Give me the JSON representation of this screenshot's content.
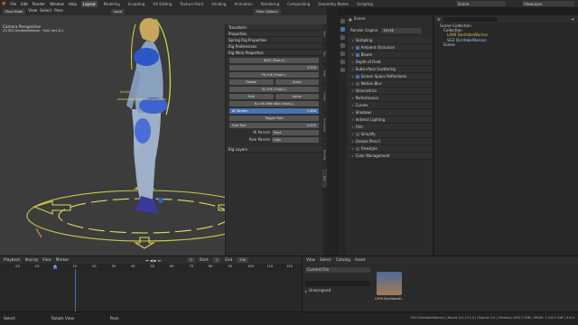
{
  "menubar": {
    "menus": [
      "File",
      "Edit",
      "Render",
      "Window",
      "Help"
    ],
    "workspaces": [
      "Layout",
      "Modeling",
      "Sculpting",
      "UV Editing",
      "Texture Paint",
      "Shading",
      "Animation",
      "Rendering",
      "Compositing",
      "Geometry Nodes",
      "Scripting"
    ],
    "active_workspace": "Layout",
    "scene_label": "Scene",
    "view_layer_label": "ViewLayer"
  },
  "viewport": {
    "mode": "Pose Mode",
    "menus": [
      "View",
      "Select",
      "Pose"
    ],
    "orientation": "Local",
    "overlay_title": "Camera Perspective",
    "overlay_sub": "(0) SG2 DoritabeWoman : Foot_Vert_B.L",
    "pose_options": "Pose Options",
    "bone_label": "Doritoboobies:0"
  },
  "npanel": {
    "sections": [
      "Transform",
      "Properties",
      "Spring Rig Properties",
      "Rig Preferences",
      "Rig Main Properties"
    ],
    "ik_fk_label": "IK-FK (Foot.L)",
    "ik_fk_value": "0.000",
    "fk_ik_label": "FK->IK (Foot.L)",
    "fk_ik_value_label": "IK->FK (Foot.L)",
    "snap_label": "IK->FK With Bob (Foot.L)",
    "ik_stretch_label": "IK Stretch",
    "ik_stretch_value": "1.000",
    "toggle_pole": "Toggle Pole",
    "toggle_pole_value": "0.000",
    "ik_parent_label": "Parent",
    "foot_roll_label": "Foot Roll",
    "roll_value": "0.000",
    "ik_parent": "IK Parent",
    "ik_parent_val": "Root",
    "pole_parent": "Pole Parent",
    "pole_parent_val": "Hips",
    "rig_layers": "Rig Layers",
    "left_col": [
      "Rotate",
      "Pole"
    ],
    "right_col": [
      "Scale",
      "Value"
    ],
    "vtabs": [
      "Item",
      "Tool",
      "View",
      "Create",
      "Animation",
      "BlenRig",
      "Rig"
    ]
  },
  "properties": {
    "scene_name": "Scene",
    "render_engine_label": "Render Engine",
    "render_engine": "EEVEE",
    "rows": [
      "Sampling",
      "Ambient Occlusion",
      "Bloom",
      "Depth of Field",
      "Subsurface Scattering",
      "Screen Space Reflections",
      "Motion Blur",
      "Volumetrics",
      "Performance",
      "Curves",
      "Shadows",
      "Indirect Lighting",
      "Film",
      "Simplify",
      "Grease Pencil",
      "Freestyle",
      "Color Management"
    ],
    "checked": [
      "Ambient Occlusion",
      "Bloom",
      "Screen Space Reflections"
    ],
    "unchecked": [
      "Motion Blur",
      "Simplify",
      "Freestyle"
    ]
  },
  "outliner": {
    "search_placeholder": "",
    "items": [
      "Scene Collection",
      "Collection",
      "L096 DoritabeWoman",
      "SG2 DoritabeWoman",
      "Scene"
    ]
  },
  "timeline": {
    "menus": [
      "Playback",
      "Keying",
      "View",
      "Marker"
    ],
    "current_frame": "0",
    "start_label": "Start",
    "start": "1",
    "end_label": "End",
    "end": "250",
    "ticks": [
      "-20",
      "-10",
      "0",
      "10",
      "20",
      "30",
      "40",
      "50",
      "60",
      "70",
      "80",
      "90",
      "100",
      "110",
      "120"
    ]
  },
  "assets": {
    "menus": [
      "View",
      "Select",
      "Catalog",
      "Asset"
    ],
    "library": "Current File",
    "search": "",
    "catalog": "Unassigned",
    "asset_name": "L096 DoritabeW..."
  },
  "statusbar": {
    "left": [
      "Select",
      "Rotate View",
      "Pose"
    ],
    "right": "SG2 DoritabeWoman | Bones 1/1,111,4 | Objects 1/1 | Memory: 835.7 MiB | VRAM: 1.1/8.0 GiB | 3.6.0"
  },
  "colors": {
    "accent": "#4772b3",
    "viewport_bg": "#3c3c3c"
  }
}
